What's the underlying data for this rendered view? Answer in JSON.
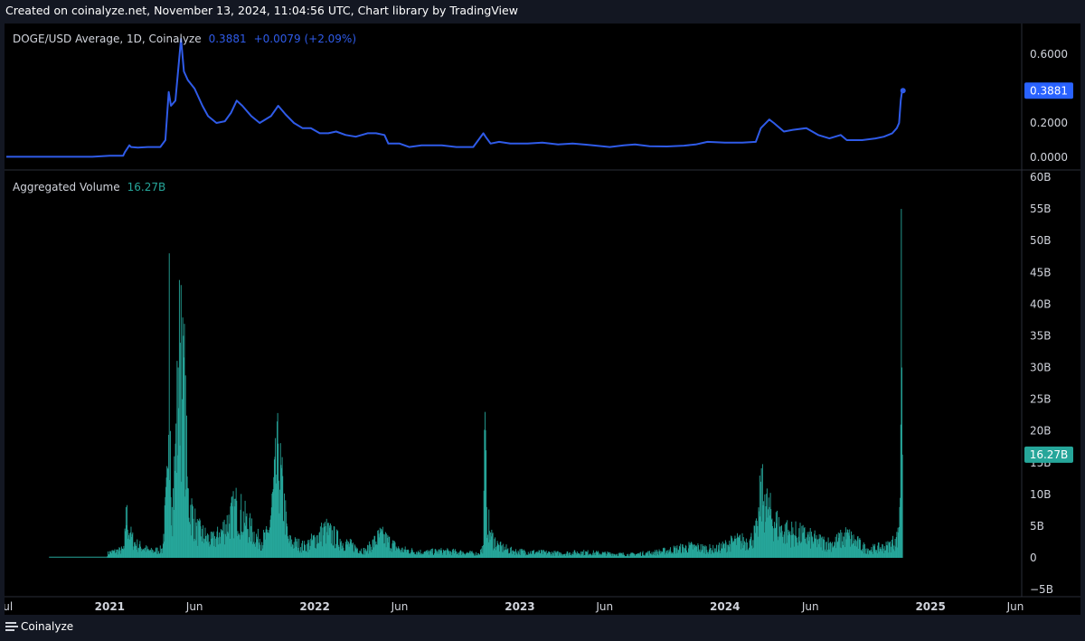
{
  "header": {
    "text": "Created on coinalyze.net, November 13, 2024, 11:04:56 UTC, Chart library by TradingView"
  },
  "footer": {
    "brand": "Coinalyze"
  },
  "colors": {
    "price_line": "#2f5be8",
    "volume_bar": "#26a69a",
    "volume_badge": "#26a69a",
    "price_badge": "#2962ff"
  },
  "chart_data": [
    {
      "type": "line",
      "legend": {
        "symbol": "DOGE/USD Average, 1D, Coinalyze",
        "last": "0.3881",
        "change": "+0.0079 (+2.09%)"
      },
      "y_ticks": [
        "0.6000",
        "0.2000",
        "0.0000"
      ],
      "last_value": 0.3881,
      "last_label": "0.3881",
      "ylim": [
        -0.02,
        0.72
      ],
      "x": [
        "2020-07-01",
        "2020-08-01",
        "2020-09-01",
        "2020-10-01",
        "2020-11-01",
        "2020-12-01",
        "2021-01-01",
        "2021-01-25",
        "2021-01-28",
        "2021-02-05",
        "2021-02-08",
        "2021-02-20",
        "2021-03-10",
        "2021-04-01",
        "2021-04-10",
        "2021-04-16",
        "2021-04-20",
        "2021-04-28",
        "2021-05-08",
        "2021-05-13",
        "2021-05-20",
        "2021-06-01",
        "2021-06-15",
        "2021-06-25",
        "2021-07-10",
        "2021-07-25",
        "2021-08-05",
        "2021-08-15",
        "2021-08-25",
        "2021-09-10",
        "2021-09-25",
        "2021-10-15",
        "2021-10-28",
        "2021-11-10",
        "2021-11-25",
        "2021-12-10",
        "2021-12-25",
        "2022-01-10",
        "2022-01-25",
        "2022-02-08",
        "2022-02-25",
        "2022-03-15",
        "2022-04-05",
        "2022-04-20",
        "2022-05-05",
        "2022-05-12",
        "2022-06-01",
        "2022-06-18",
        "2022-07-10",
        "2022-08-15",
        "2022-09-10",
        "2022-10-10",
        "2022-10-28",
        "2022-11-01",
        "2022-11-10",
        "2022-11-25",
        "2022-12-15",
        "2023-01-15",
        "2023-02-10",
        "2023-03-10",
        "2023-04-05",
        "2023-05-01",
        "2023-06-10",
        "2023-07-05",
        "2023-07-25",
        "2023-08-20",
        "2023-09-20",
        "2023-10-20",
        "2023-11-10",
        "2023-12-01",
        "2024-01-01",
        "2024-02-01",
        "2024-02-25",
        "2024-03-05",
        "2024-03-20",
        "2024-03-28",
        "2024-04-15",
        "2024-05-01",
        "2024-05-25",
        "2024-06-15",
        "2024-07-05",
        "2024-07-25",
        "2024-08-05",
        "2024-09-01",
        "2024-09-25",
        "2024-10-10",
        "2024-10-25",
        "2024-11-02",
        "2024-11-06",
        "2024-11-09",
        "2024-11-11",
        "2024-11-13"
      ],
      "y": [
        0.003,
        0.003,
        0.003,
        0.003,
        0.003,
        0.003,
        0.009,
        0.009,
        0.03,
        0.07,
        0.06,
        0.057,
        0.06,
        0.06,
        0.1,
        0.38,
        0.3,
        0.33,
        0.69,
        0.5,
        0.45,
        0.4,
        0.3,
        0.24,
        0.2,
        0.21,
        0.26,
        0.33,
        0.3,
        0.24,
        0.2,
        0.24,
        0.3,
        0.25,
        0.2,
        0.17,
        0.17,
        0.14,
        0.14,
        0.15,
        0.13,
        0.12,
        0.14,
        0.14,
        0.13,
        0.08,
        0.08,
        0.06,
        0.07,
        0.07,
        0.06,
        0.06,
        0.14,
        0.12,
        0.08,
        0.09,
        0.08,
        0.08,
        0.085,
        0.075,
        0.08,
        0.073,
        0.06,
        0.07,
        0.075,
        0.065,
        0.063,
        0.068,
        0.075,
        0.09,
        0.085,
        0.085,
        0.09,
        0.17,
        0.22,
        0.2,
        0.15,
        0.16,
        0.17,
        0.13,
        0.11,
        0.13,
        0.1,
        0.1,
        0.11,
        0.12,
        0.14,
        0.17,
        0.2,
        0.33,
        0.38,
        0.3881
      ]
    },
    {
      "type": "bar",
      "legend": {
        "title": "Aggregated Volume",
        "last": "16.27B"
      },
      "y_ticks": [
        "60B",
        "55B",
        "50B",
        "45B",
        "40B",
        "35B",
        "30B",
        "25B",
        "20B",
        "15B",
        "10B",
        "5B",
        "0",
        "−5B"
      ],
      "last_value": 16.27,
      "last_label": "16.27B",
      "unit": "B",
      "ylim": [
        -5,
        60
      ],
      "anchors_x": [
        "2020-07-01",
        "2020-12-20",
        "2021-01-01",
        "2021-01-27",
        "2021-01-30",
        "2021-02-07",
        "2021-02-15",
        "2021-03-15",
        "2021-04-05",
        "2021-04-15",
        "2021-04-17",
        "2021-04-19",
        "2021-04-22",
        "2021-04-28",
        "2021-05-03",
        "2021-05-08",
        "2021-05-10",
        "2021-05-12",
        "2021-05-20",
        "2021-06-05",
        "2021-07-01",
        "2021-07-15",
        "2021-08-15",
        "2021-09-10",
        "2021-09-25",
        "2021-10-10",
        "2021-10-28",
        "2021-11-15",
        "2021-12-15",
        "2022-01-20",
        "2022-02-15",
        "2022-04-01",
        "2022-04-28",
        "2022-06-01",
        "2022-07-15",
        "2022-08-15",
        "2022-09-20",
        "2022-10-20",
        "2022-10-28",
        "2022-10-31",
        "2022-11-03",
        "2022-11-10",
        "2022-11-25",
        "2022-12-20",
        "2023-02-01",
        "2023-03-15",
        "2023-04-20",
        "2023-06-01",
        "2023-07-15",
        "2023-09-01",
        "2023-11-01",
        "2023-12-15",
        "2024-01-20",
        "2024-02-15",
        "2024-02-28",
        "2024-03-05",
        "2024-03-12",
        "2024-03-20",
        "2024-04-10",
        "2024-05-20",
        "2024-06-15",
        "2024-07-10",
        "2024-08-05",
        "2024-09-10",
        "2024-10-15",
        "2024-10-30",
        "2024-11-05",
        "2024-11-07",
        "2024-11-09",
        "2024-11-10",
        "2024-11-11",
        "2024-11-12",
        "2024-11-13"
      ],
      "anchors_y": [
        0.2,
        0.2,
        1,
        1.5,
        8,
        4,
        2.5,
        1.2,
        1.5,
        14,
        48,
        20,
        8,
        18,
        30,
        43,
        25,
        35,
        11,
        5,
        3,
        4,
        9,
        5,
        3,
        4,
        18,
        3,
        2,
        5,
        3,
        1.2,
        4,
        1.5,
        1,
        1.2,
        1,
        0.7,
        2,
        23,
        8,
        4,
        2,
        1.2,
        1,
        0.8,
        1,
        0.8,
        0.6,
        1,
        2,
        1.5,
        3,
        3,
        5,
        12,
        10,
        8,
        5,
        4,
        3,
        2.5,
        4,
        1.5,
        2,
        3,
        4,
        8,
        21,
        55,
        30,
        16.27
      ]
    }
  ],
  "x_axis": {
    "labels": [
      "Jul",
      "2021",
      "Jun",
      "2022",
      "Jun",
      "2023",
      "Jun",
      "2024",
      "Jun",
      "2025",
      "Jun"
    ],
    "dates": [
      "2020-07-01",
      "2021-01-01",
      "2021-06-01",
      "2022-01-01",
      "2022-06-01",
      "2023-01-01",
      "2023-06-01",
      "2024-01-01",
      "2024-06-01",
      "2025-01-01",
      "2025-06-01"
    ]
  }
}
